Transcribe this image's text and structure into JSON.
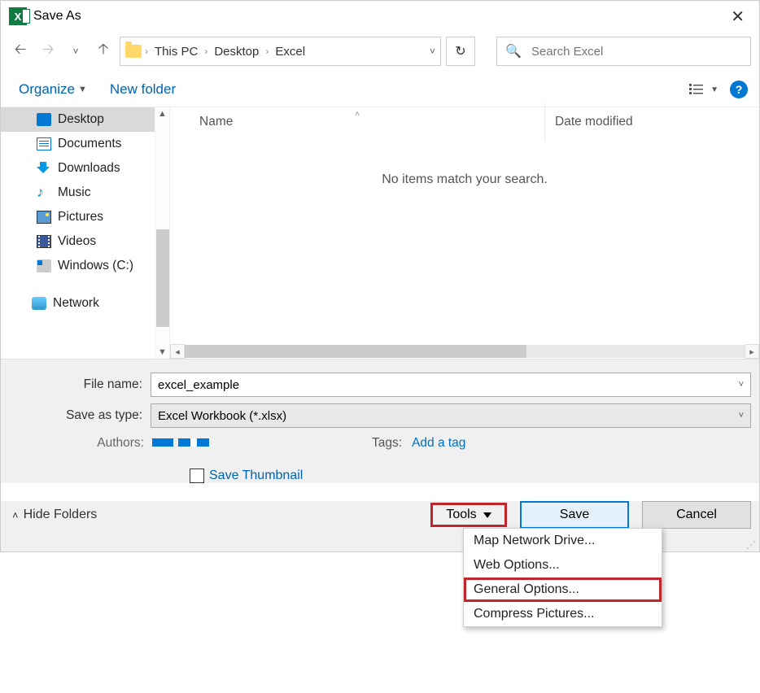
{
  "title": "Save As",
  "breadcrumbs": {
    "root": "This PC",
    "mid": "Desktop",
    "leaf": "Excel"
  },
  "search_placeholder": "Search Excel",
  "toolbar": {
    "organize": "Organize",
    "newfolder": "New folder"
  },
  "sidebar": {
    "items": [
      {
        "label": "Desktop"
      },
      {
        "label": "Documents"
      },
      {
        "label": "Downloads"
      },
      {
        "label": "Music"
      },
      {
        "label": "Pictures"
      },
      {
        "label": "Videos"
      },
      {
        "label": "Windows (C:)"
      }
    ],
    "network": "Network"
  },
  "columns": {
    "name": "Name",
    "date": "Date modified"
  },
  "empty_message": "No items match your search.",
  "form": {
    "filename_label": "File name:",
    "filename_value": "excel_example",
    "savetype_label": "Save as type:",
    "savetype_value": "Excel Workbook (*.xlsx)",
    "authors_label": "Authors:",
    "tags_label": "Tags:",
    "add_tag": "Add a tag",
    "save_thumbnail": "Save Thumbnail"
  },
  "buttons": {
    "hide_folders": "Hide Folders",
    "tools": "Tools",
    "save": "Save",
    "cancel": "Cancel"
  },
  "tools_menu": {
    "item1": "Map Network Drive...",
    "item2": "Web Options...",
    "item3": "General Options...",
    "item4": "Compress Pictures..."
  }
}
